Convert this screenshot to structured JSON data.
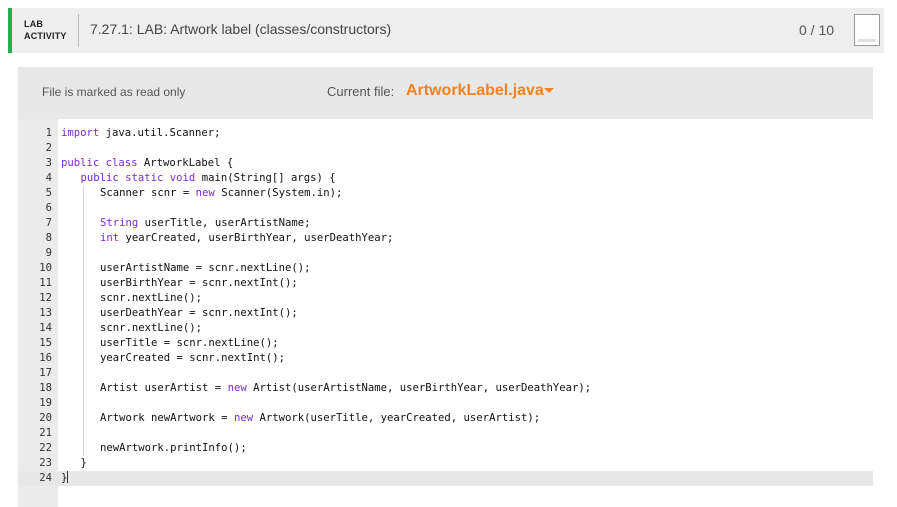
{
  "header": {
    "badge_line1": "LAB",
    "badge_line2": "ACTIVITY",
    "title": "7.27.1: LAB: Artwork label (classes/constructors)",
    "score": "0 / 10",
    "accent_color": "#22b14c"
  },
  "filebar": {
    "readonly_text": "File is marked as read only",
    "current_file_label": "Current file:",
    "current_file_name": "ArtworkLabel.java",
    "dropdown_icon": "caret-down-icon",
    "accent_color": "#f5821f"
  },
  "editor": {
    "keyword_color": "#7b2ec6",
    "active_line": 24,
    "lines": [
      {
        "n": "1",
        "indent": 0,
        "segs": [
          [
            "k",
            "import"
          ],
          [
            "t",
            " java.util.Scanner;"
          ]
        ]
      },
      {
        "n": "2",
        "indent": 0,
        "segs": []
      },
      {
        "n": "3",
        "indent": 0,
        "segs": [
          [
            "k",
            "public class"
          ],
          [
            "t",
            " ArtworkLabel {"
          ]
        ]
      },
      {
        "n": "4",
        "indent": 1,
        "segs": [
          [
            "k",
            "public static void"
          ],
          [
            "t",
            " main(String[] args) {"
          ]
        ]
      },
      {
        "n": "5",
        "indent": 2,
        "segs": [
          [
            "t",
            "Scanner scnr = "
          ],
          [
            "k",
            "new"
          ],
          [
            "t",
            " Scanner(System.in);"
          ]
        ]
      },
      {
        "n": "6",
        "indent": 2,
        "segs": []
      },
      {
        "n": "7",
        "indent": 2,
        "segs": [
          [
            "k",
            "String"
          ],
          [
            "t",
            " userTitle, userArtistName;"
          ]
        ]
      },
      {
        "n": "8",
        "indent": 2,
        "segs": [
          [
            "k",
            "int"
          ],
          [
            "t",
            " yearCreated, userBirthYear, userDeathYear;"
          ]
        ]
      },
      {
        "n": "9",
        "indent": 2,
        "segs": []
      },
      {
        "n": "10",
        "indent": 2,
        "segs": [
          [
            "t",
            "userArtistName = scnr.nextLine();"
          ]
        ]
      },
      {
        "n": "11",
        "indent": 2,
        "segs": [
          [
            "t",
            "userBirthYear = scnr.nextInt();"
          ]
        ]
      },
      {
        "n": "12",
        "indent": 2,
        "segs": [
          [
            "t",
            "scnr.nextLine();"
          ]
        ]
      },
      {
        "n": "13",
        "indent": 2,
        "segs": [
          [
            "t",
            "userDeathYear = scnr.nextInt();"
          ]
        ]
      },
      {
        "n": "14",
        "indent": 2,
        "segs": [
          [
            "t",
            "scnr.nextLine();"
          ]
        ]
      },
      {
        "n": "15",
        "indent": 2,
        "segs": [
          [
            "t",
            "userTitle = scnr.nextLine();"
          ]
        ]
      },
      {
        "n": "16",
        "indent": 2,
        "segs": [
          [
            "t",
            "yearCreated = scnr.nextInt();"
          ]
        ]
      },
      {
        "n": "17",
        "indent": 2,
        "segs": []
      },
      {
        "n": "18",
        "indent": 2,
        "segs": [
          [
            "t",
            "Artist userArtist = "
          ],
          [
            "k",
            "new"
          ],
          [
            "t",
            " Artist(userArtistName, userBirthYear, userDeathYear);"
          ]
        ]
      },
      {
        "n": "19",
        "indent": 2,
        "segs": []
      },
      {
        "n": "20",
        "indent": 2,
        "segs": [
          [
            "t",
            "Artwork newArtwork = "
          ],
          [
            "k",
            "new"
          ],
          [
            "t",
            " Artwork(userTitle, yearCreated, userArtist);"
          ]
        ]
      },
      {
        "n": "21",
        "indent": 2,
        "segs": []
      },
      {
        "n": "22",
        "indent": 2,
        "segs": [
          [
            "t",
            "newArtwork.printInfo();"
          ]
        ]
      },
      {
        "n": "23",
        "indent": 1,
        "segs": [
          [
            "t",
            "}"
          ]
        ]
      },
      {
        "n": "24",
        "indent": 0,
        "segs": [
          [
            "t",
            "}"
          ]
        ]
      }
    ]
  }
}
